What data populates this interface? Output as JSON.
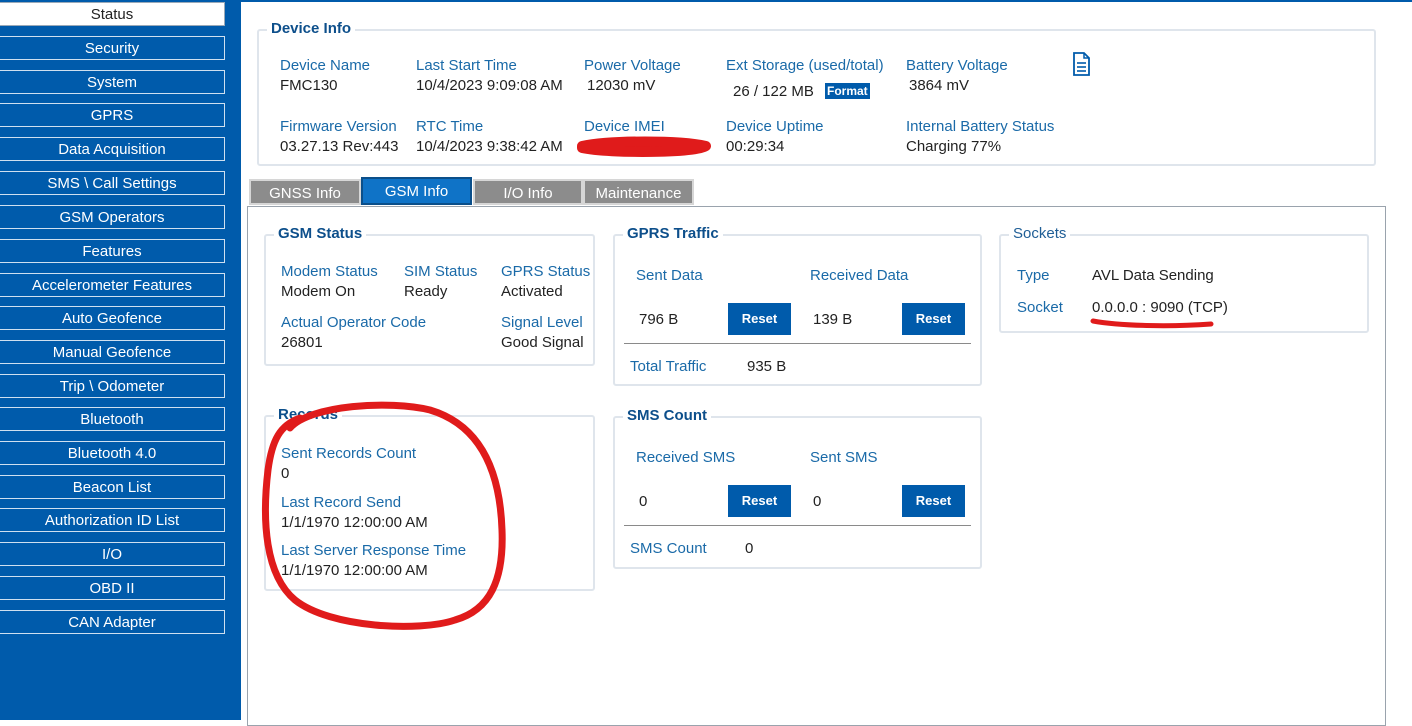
{
  "sidebar": {
    "items": [
      {
        "label": "Status",
        "active": true
      },
      {
        "label": "Security"
      },
      {
        "label": "System"
      },
      {
        "label": "GPRS"
      },
      {
        "label": "Data Acquisition"
      },
      {
        "label": "SMS \\ Call Settings"
      },
      {
        "label": "GSM Operators"
      },
      {
        "label": "Features"
      },
      {
        "label": "Accelerometer Features"
      },
      {
        "label": "Auto Geofence"
      },
      {
        "label": "Manual Geofence"
      },
      {
        "label": "Trip \\ Odometer"
      },
      {
        "label": "Bluetooth"
      },
      {
        "label": "Bluetooth 4.0"
      },
      {
        "label": "Beacon List"
      },
      {
        "label": "Authorization ID List"
      },
      {
        "label": "I/O"
      },
      {
        "label": "OBD II"
      },
      {
        "label": "CAN Adapter"
      }
    ]
  },
  "device_info": {
    "title": "Device Info",
    "device_name_label": "Device Name",
    "device_name": "FMC130",
    "last_start_label": "Last Start Time",
    "last_start": "10/4/2023 9:09:08 AM",
    "power_voltage_label": "Power Voltage",
    "power_voltage": "12030 mV",
    "ext_storage_label": "Ext Storage (used/total)",
    "ext_storage": "26 / 122 MB",
    "format_label": "Format",
    "battery_voltage_label": "Battery Voltage",
    "battery_voltage": "3864 mV",
    "firmware_label": "Firmware Version",
    "firmware": "03.27.13 Rev:443",
    "rtc_label": "RTC Time",
    "rtc": "10/4/2023 9:38:42 AM",
    "imei_label": "Device IMEI",
    "uptime_label": "Device Uptime",
    "uptime": "00:29:34",
    "internal_battery_label": "Internal Battery Status",
    "internal_battery": "Charging 77%"
  },
  "tabs": [
    {
      "label": "GNSS Info"
    },
    {
      "label": "GSM Info",
      "active": true
    },
    {
      "label": "I/O Info"
    },
    {
      "label": "Maintenance"
    }
  ],
  "gsm_status": {
    "title": "GSM Status",
    "modem_status_label": "Modem Status",
    "modem_status": "Modem On",
    "sim_status_label": "SIM Status",
    "sim_status": "Ready",
    "gprs_status_label": "GPRS Status",
    "gprs_status": "Activated",
    "operator_code_label": "Actual Operator Code",
    "operator_code": "26801",
    "signal_level_label": "Signal Level",
    "signal_level": "Good Signal"
  },
  "gprs_traffic": {
    "title": "GPRS Traffic",
    "sent_label": "Sent Data",
    "sent": "796 B",
    "received_label": "Received Data",
    "received": "139 B",
    "reset_label": "Reset",
    "total_label": "Total Traffic",
    "total": "935 B"
  },
  "sockets": {
    "title": "Sockets",
    "type_label": "Type",
    "type": "AVL Data Sending",
    "socket_label": "Socket",
    "socket": "0.0.0.0 : 9090 (TCP)"
  },
  "records": {
    "title": "Records",
    "sent_count_label": "Sent Records Count",
    "sent_count": "0",
    "last_send_label": "Last Record Send",
    "last_send": "1/1/1970 12:00:00 AM",
    "last_response_label": "Last Server Response Time",
    "last_response": "1/1/1970 12:00:00 AM"
  },
  "sms_count": {
    "title": "SMS Count",
    "received_label": "Received SMS",
    "received": "0",
    "sent_label": "Sent SMS",
    "sent": "0",
    "reset_label": "Reset",
    "count_label": "SMS Count",
    "count": "0"
  },
  "colors": {
    "brand_blue": "#005bab",
    "label_blue": "#1a6aa8",
    "annotation_red": "#e01b1b"
  }
}
